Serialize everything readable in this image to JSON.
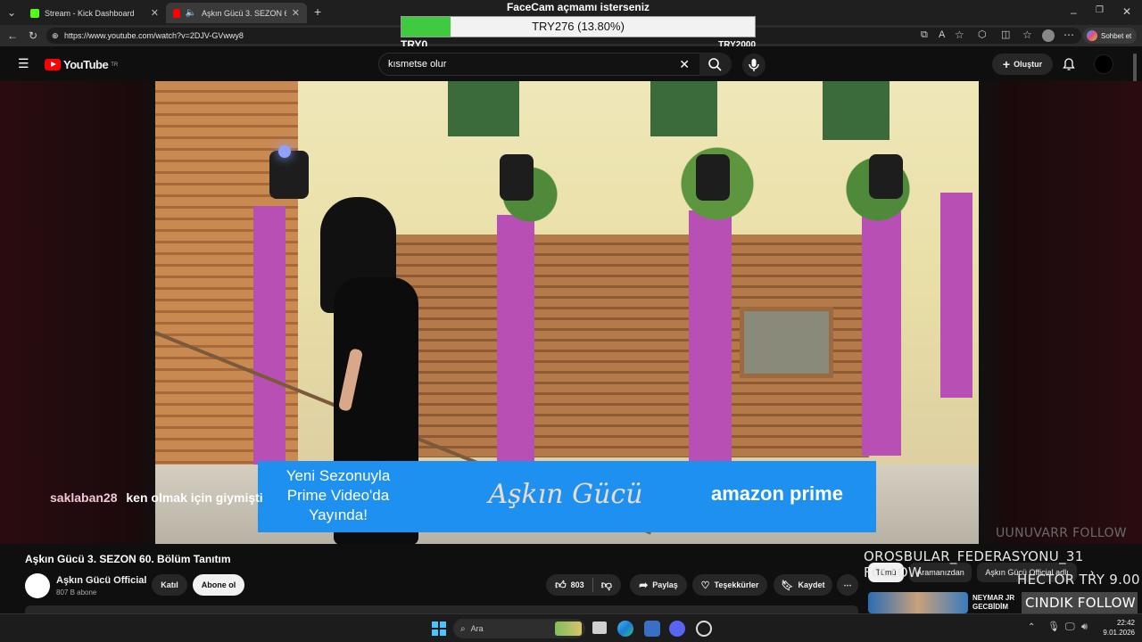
{
  "tabs": [
    {
      "label": "Stream - Kick Dashboard",
      "color": "#53fc18"
    },
    {
      "label": "Aşkın Gücü 3. SEZON 60. Bölü",
      "color": "#ff0000"
    }
  ],
  "browser": {
    "url": "https://www.youtube.com/watch?v=2DJV-GVwwy8",
    "copilot_label": "Sohbet et"
  },
  "youtube": {
    "logo": "YouTube",
    "region": "TR",
    "search_value": "kısmetse olur",
    "create_label": "Oluştur"
  },
  "donation_goal": {
    "title": "FaceCam açmamı isterseniz",
    "progress_text": "TRY276 (13.80%)",
    "progress": 0.138,
    "min_label": "TRY0",
    "max_label": "TRY2000"
  },
  "video": {
    "title": "Aşkın Gücü 3. SEZON 60. Bölüm Tanıtım",
    "channel": "Aşkın Gücü Official",
    "subscribers": "807 B abone",
    "join_label": "Katıl",
    "subscribe_label": "Abone ol",
    "likes": "803",
    "share_label": "Paylaş",
    "thanks_label": "Teşekkürler",
    "save_label": "Kaydet",
    "banner": {
      "left_text_1": "Yeni Sezonuyla",
      "left_text_2": "Prime Video'da",
      "left_text_3": "Yayında!",
      "logo": "Aşkın Gücü",
      "brand": "amazon prime"
    }
  },
  "chat_overlay": {
    "user": "saklaban28",
    "message": "ken olmak için giymişti"
  },
  "follow_alerts": [
    {
      "text": "UUNUVARR FOLLOW"
    },
    {
      "text": "OROSBULAR_FEDERASYONU_31 FOLLOW"
    },
    {
      "text": "HECTOR TRY 9.00"
    },
    {
      "text": "CINDIK FOLLOW"
    }
  ],
  "filter_chips": [
    "Tümü",
    "Aramanızdan",
    "Aşkın Gücü Official adlı"
  ],
  "recommendation": {
    "title_1": "NEYMAR JR",
    "title_2": "GECBİDİM"
  },
  "taskbar": {
    "search_placeholder": "Ara",
    "time": "22:42",
    "date": "9.01.2026"
  }
}
